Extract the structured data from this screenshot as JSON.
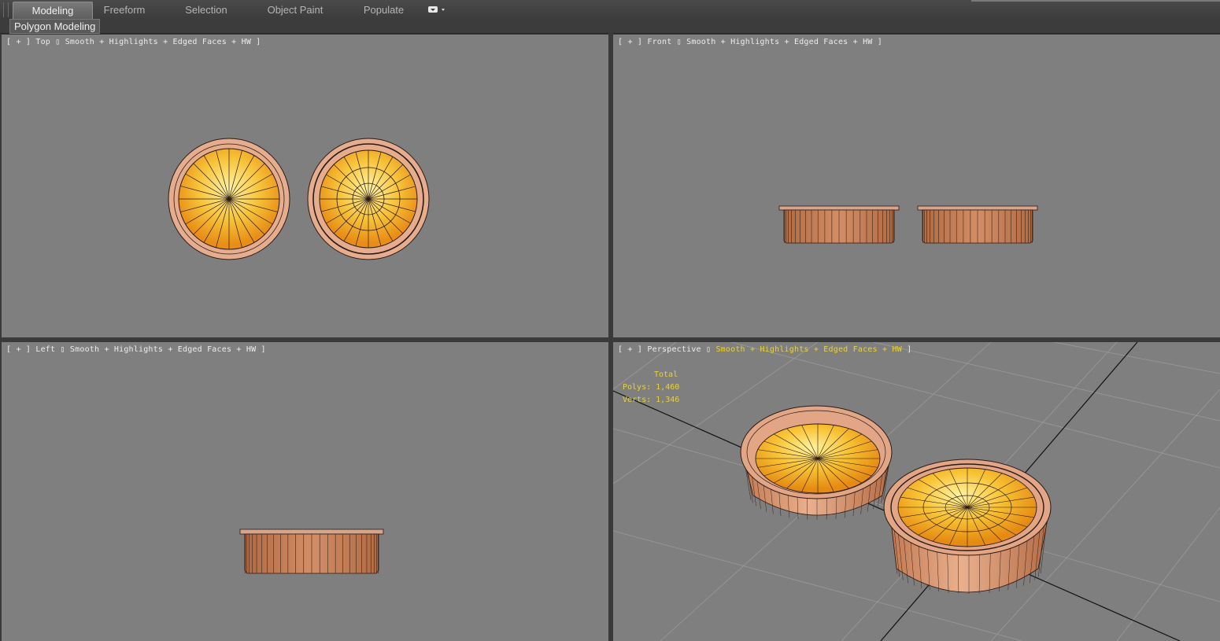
{
  "ribbon": {
    "tabs": [
      {
        "label": "Modeling",
        "active": true
      },
      {
        "label": "Freeform",
        "active": false
      },
      {
        "label": "Selection",
        "active": false
      },
      {
        "label": "Object Paint",
        "active": false
      },
      {
        "label": "Populate",
        "active": false
      }
    ],
    "panel_label": "Polygon Modeling"
  },
  "viewports": {
    "top": {
      "plus": "[ + ]",
      "name": "Top",
      "shading": "Smooth + Highlights + Edged Faces + HW ]"
    },
    "front": {
      "plus": "[ + ]",
      "name": "Front",
      "shading": "Smooth + Highlights + Edged Faces + HW ]"
    },
    "left": {
      "plus": "[ + ]",
      "name": "Left",
      "shading": "Smooth + Highlights + Edged Faces + HW ]"
    },
    "perspective": {
      "plus": "[ + ]",
      "name": "Perspective",
      "shading": "Smooth + Highlights + Edged Faces + HW",
      "shading_end": "]"
    }
  },
  "stats": {
    "title": "Total",
    "polys_label": "Polys:",
    "polys_value": "1,460",
    "verts_label": "Verts:",
    "verts_value": "1,346"
  },
  "colors": {
    "viewport_bg": "#7f7f7f",
    "active_label": "#e8d23a",
    "tart_fill": "#f5a623",
    "crust_fill": "#d99a78"
  }
}
